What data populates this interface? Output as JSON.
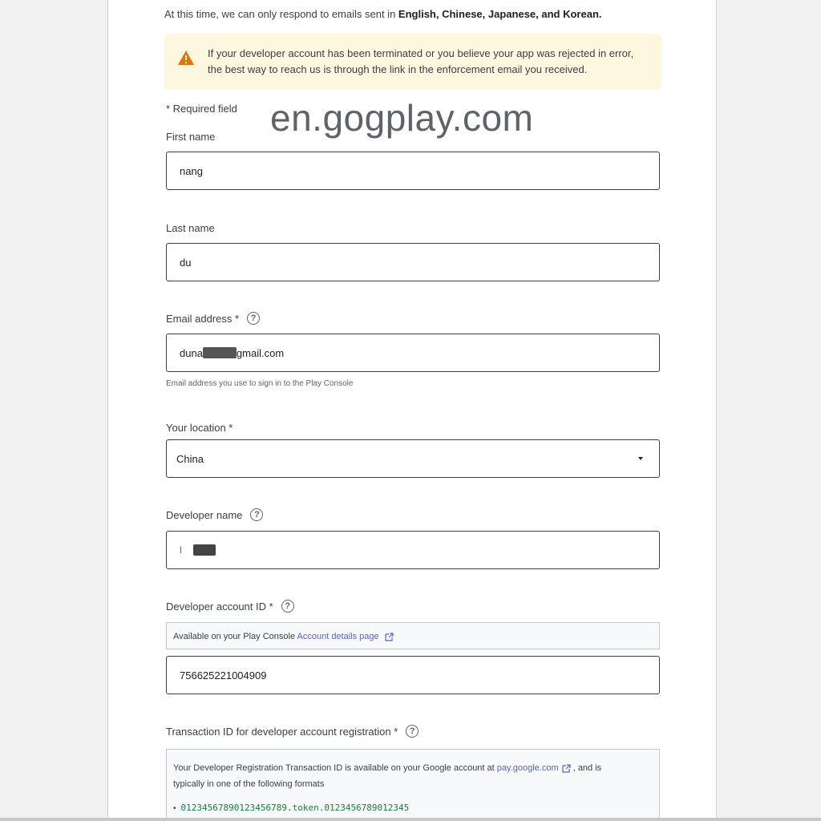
{
  "intro": {
    "prefix": "At this time, we can only respond to emails sent in ",
    "languages": "English, Chinese, Japanese, and Korean."
  },
  "warning": {
    "icon": "warning-triangle-icon",
    "color": "#e37400",
    "text": "If your developer account has been terminated or you believe your app was rejected in error, the best way to reach us is through the link in the enforcement email you received."
  },
  "watermark": "en.gogplay.com",
  "form": {
    "required_note": "* Required field",
    "first_name": {
      "label": "First name",
      "value": "nang"
    },
    "last_name": {
      "label": "Last name",
      "value": "du"
    },
    "email": {
      "label": "Email address *",
      "value_prefix": "duna",
      "value_suffix": "gmail.com",
      "hint": "Email address you use to sign in to the Play Console"
    },
    "location": {
      "label": "Your location *",
      "value": "China"
    },
    "developer_name": {
      "label": "Developer name",
      "value": "l"
    },
    "developer_account_id": {
      "label": "Developer account ID *",
      "info_prefix": "Available on your Play Console ",
      "info_link": "Account details page",
      "value": "756625221004909"
    },
    "transaction_id": {
      "label": "Transaction ID for developer account registration *",
      "info_prefix": "Your Developer Registration Transaction ID is available on your Google account at ",
      "info_link": "pay.google.com",
      "info_suffix": ", and is",
      "info_line2": "typically in one of the following formats",
      "format_1": "01234567890123456789.token.0123456789012345"
    }
  }
}
